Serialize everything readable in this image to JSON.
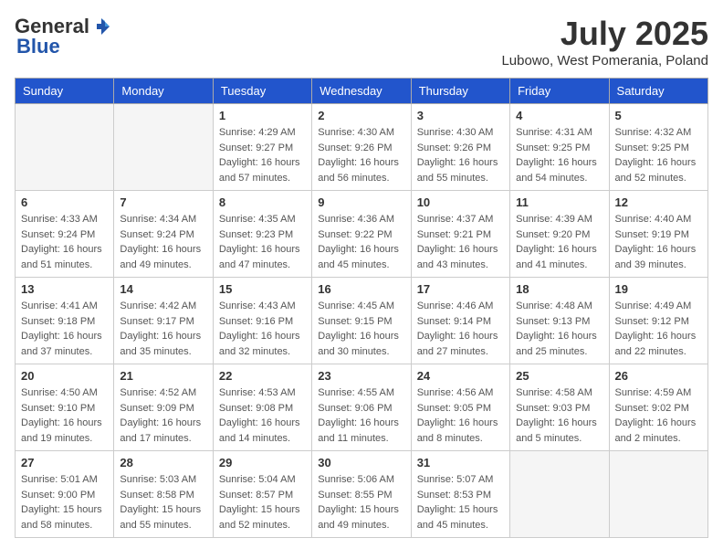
{
  "header": {
    "logo_general": "General",
    "logo_blue": "Blue",
    "month_title": "July 2025",
    "location": "Lubowo, West Pomerania, Poland"
  },
  "days_of_week": [
    "Sunday",
    "Monday",
    "Tuesday",
    "Wednesday",
    "Thursday",
    "Friday",
    "Saturday"
  ],
  "weeks": [
    [
      {
        "day": "",
        "info": ""
      },
      {
        "day": "",
        "info": ""
      },
      {
        "day": "1",
        "info": "Sunrise: 4:29 AM\nSunset: 9:27 PM\nDaylight: 16 hours\nand 57 minutes."
      },
      {
        "day": "2",
        "info": "Sunrise: 4:30 AM\nSunset: 9:26 PM\nDaylight: 16 hours\nand 56 minutes."
      },
      {
        "day": "3",
        "info": "Sunrise: 4:30 AM\nSunset: 9:26 PM\nDaylight: 16 hours\nand 55 minutes."
      },
      {
        "day": "4",
        "info": "Sunrise: 4:31 AM\nSunset: 9:25 PM\nDaylight: 16 hours\nand 54 minutes."
      },
      {
        "day": "5",
        "info": "Sunrise: 4:32 AM\nSunset: 9:25 PM\nDaylight: 16 hours\nand 52 minutes."
      }
    ],
    [
      {
        "day": "6",
        "info": "Sunrise: 4:33 AM\nSunset: 9:24 PM\nDaylight: 16 hours\nand 51 minutes."
      },
      {
        "day": "7",
        "info": "Sunrise: 4:34 AM\nSunset: 9:24 PM\nDaylight: 16 hours\nand 49 minutes."
      },
      {
        "day": "8",
        "info": "Sunrise: 4:35 AM\nSunset: 9:23 PM\nDaylight: 16 hours\nand 47 minutes."
      },
      {
        "day": "9",
        "info": "Sunrise: 4:36 AM\nSunset: 9:22 PM\nDaylight: 16 hours\nand 45 minutes."
      },
      {
        "day": "10",
        "info": "Sunrise: 4:37 AM\nSunset: 9:21 PM\nDaylight: 16 hours\nand 43 minutes."
      },
      {
        "day": "11",
        "info": "Sunrise: 4:39 AM\nSunset: 9:20 PM\nDaylight: 16 hours\nand 41 minutes."
      },
      {
        "day": "12",
        "info": "Sunrise: 4:40 AM\nSunset: 9:19 PM\nDaylight: 16 hours\nand 39 minutes."
      }
    ],
    [
      {
        "day": "13",
        "info": "Sunrise: 4:41 AM\nSunset: 9:18 PM\nDaylight: 16 hours\nand 37 minutes."
      },
      {
        "day": "14",
        "info": "Sunrise: 4:42 AM\nSunset: 9:17 PM\nDaylight: 16 hours\nand 35 minutes."
      },
      {
        "day": "15",
        "info": "Sunrise: 4:43 AM\nSunset: 9:16 PM\nDaylight: 16 hours\nand 32 minutes."
      },
      {
        "day": "16",
        "info": "Sunrise: 4:45 AM\nSunset: 9:15 PM\nDaylight: 16 hours\nand 30 minutes."
      },
      {
        "day": "17",
        "info": "Sunrise: 4:46 AM\nSunset: 9:14 PM\nDaylight: 16 hours\nand 27 minutes."
      },
      {
        "day": "18",
        "info": "Sunrise: 4:48 AM\nSunset: 9:13 PM\nDaylight: 16 hours\nand 25 minutes."
      },
      {
        "day": "19",
        "info": "Sunrise: 4:49 AM\nSunset: 9:12 PM\nDaylight: 16 hours\nand 22 minutes."
      }
    ],
    [
      {
        "day": "20",
        "info": "Sunrise: 4:50 AM\nSunset: 9:10 PM\nDaylight: 16 hours\nand 19 minutes."
      },
      {
        "day": "21",
        "info": "Sunrise: 4:52 AM\nSunset: 9:09 PM\nDaylight: 16 hours\nand 17 minutes."
      },
      {
        "day": "22",
        "info": "Sunrise: 4:53 AM\nSunset: 9:08 PM\nDaylight: 16 hours\nand 14 minutes."
      },
      {
        "day": "23",
        "info": "Sunrise: 4:55 AM\nSunset: 9:06 PM\nDaylight: 16 hours\nand 11 minutes."
      },
      {
        "day": "24",
        "info": "Sunrise: 4:56 AM\nSunset: 9:05 PM\nDaylight: 16 hours\nand 8 minutes."
      },
      {
        "day": "25",
        "info": "Sunrise: 4:58 AM\nSunset: 9:03 PM\nDaylight: 16 hours\nand 5 minutes."
      },
      {
        "day": "26",
        "info": "Sunrise: 4:59 AM\nSunset: 9:02 PM\nDaylight: 16 hours\nand 2 minutes."
      }
    ],
    [
      {
        "day": "27",
        "info": "Sunrise: 5:01 AM\nSunset: 9:00 PM\nDaylight: 15 hours\nand 58 minutes."
      },
      {
        "day": "28",
        "info": "Sunrise: 5:03 AM\nSunset: 8:58 PM\nDaylight: 15 hours\nand 55 minutes."
      },
      {
        "day": "29",
        "info": "Sunrise: 5:04 AM\nSunset: 8:57 PM\nDaylight: 15 hours\nand 52 minutes."
      },
      {
        "day": "30",
        "info": "Sunrise: 5:06 AM\nSunset: 8:55 PM\nDaylight: 15 hours\nand 49 minutes."
      },
      {
        "day": "31",
        "info": "Sunrise: 5:07 AM\nSunset: 8:53 PM\nDaylight: 15 hours\nand 45 minutes."
      },
      {
        "day": "",
        "info": ""
      },
      {
        "day": "",
        "info": ""
      }
    ]
  ]
}
